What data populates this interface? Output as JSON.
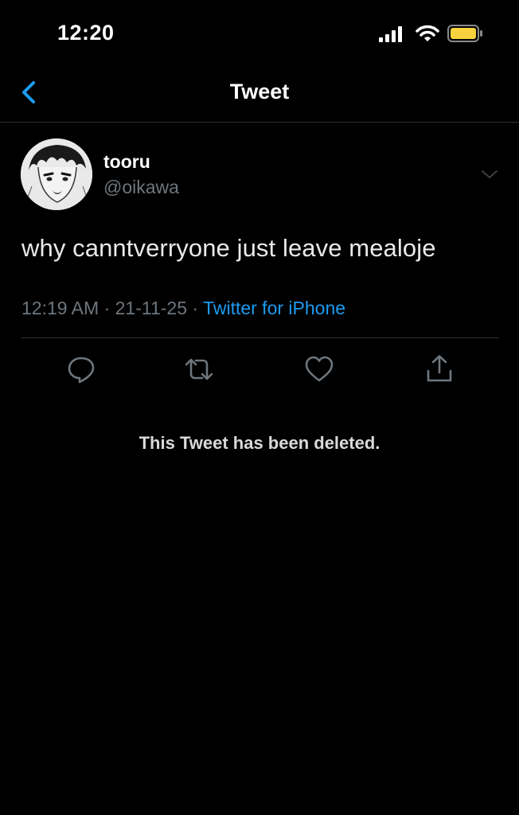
{
  "status_bar": {
    "time": "12:20",
    "icons": [
      "cellular-signal-icon",
      "wifi-icon",
      "battery-icon"
    ],
    "battery_color": "#f7d23e"
  },
  "nav": {
    "back_icon": "chevron-left-icon",
    "title": "Tweet"
  },
  "tweet": {
    "display_name": "tooru",
    "handle": "@oikawa",
    "text": "why canntverryone just leave mealoje",
    "time": "12:19 AM",
    "separator": "·",
    "date": "21-11-25",
    "source": "Twitter for iPhone",
    "menu_icon": "chevron-down-icon"
  },
  "actions": [
    {
      "icon": "reply-icon"
    },
    {
      "icon": "retweet-icon"
    },
    {
      "icon": "like-icon"
    },
    {
      "icon": "share-icon"
    }
  ],
  "notice": "This Tweet has been deleted.",
  "colors": {
    "background": "#000000",
    "accent": "#1d9bf0",
    "secondary_text": "#6e767d",
    "divider": "#2f3336"
  }
}
